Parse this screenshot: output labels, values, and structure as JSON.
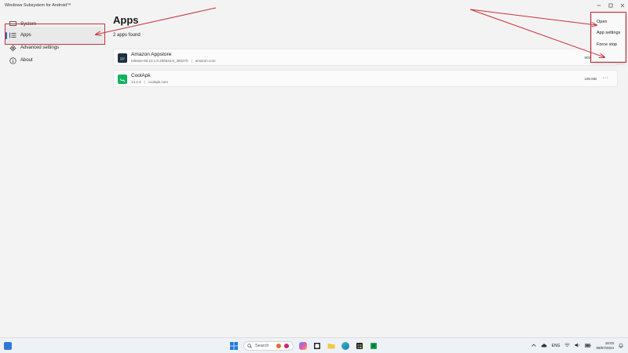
{
  "window": {
    "title": "Windows Subsystem for Android™"
  },
  "sidebar": {
    "items": [
      {
        "label": "System",
        "icon": "monitor-icon"
      },
      {
        "label": "Apps",
        "icon": "apps-list-icon",
        "active": true
      },
      {
        "label": "Advanced settings",
        "icon": "gear-icon"
      },
      {
        "label": "About",
        "icon": "info-icon"
      }
    ]
  },
  "main": {
    "title": "Apps",
    "count_text": "2 apps found",
    "apps": [
      {
        "name": "Amazon Appstore",
        "version": "release-60.10.1.0.206644.0_360270",
        "source": "amazon.com",
        "size": "900 MB",
        "icon_color": "#232f3e"
      },
      {
        "name": "CoolApk",
        "version": "14.2.3",
        "source": "coolapk.com",
        "size": "195 MB",
        "icon_color": "#11b35e"
      }
    ],
    "more_label": "···"
  },
  "context_menu": {
    "items": [
      "Open",
      "App settings",
      "Force stop"
    ]
  },
  "taskbar": {
    "search_placeholder": "Search",
    "language": "ENG",
    "time": "18:03",
    "date": "09/07/2024"
  },
  "colors": {
    "accent": "#2a66b5",
    "annotation": "#c8323c"
  }
}
